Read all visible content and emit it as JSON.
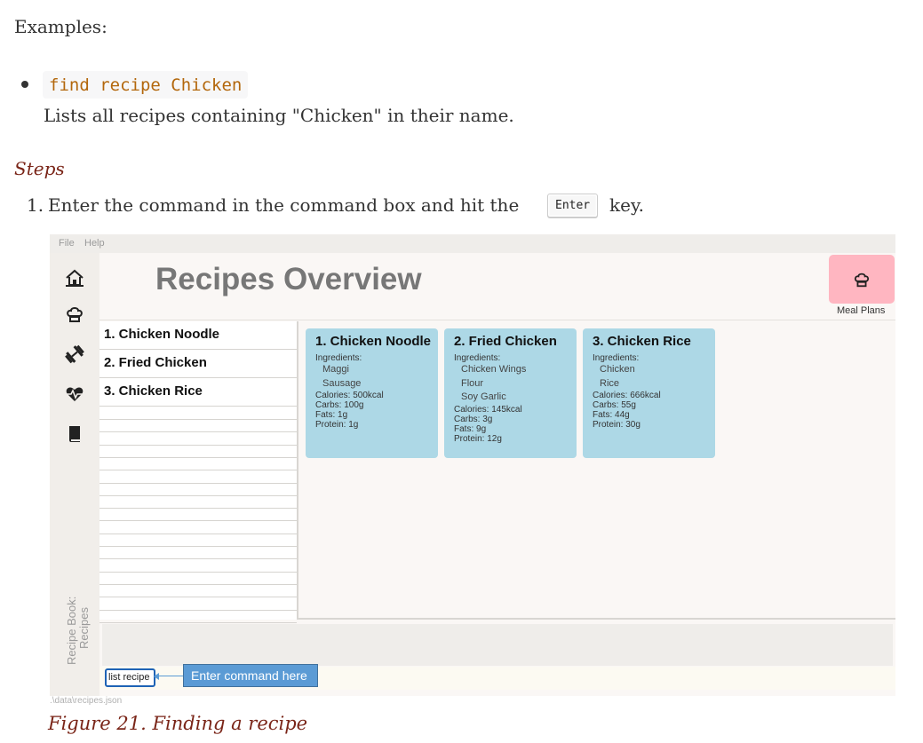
{
  "doc": {
    "examples_heading": "Examples:",
    "example_command": "find recipe Chicken",
    "example_description": "Lists all recipes containing \"Chicken\" in their name.",
    "steps_heading": "Steps",
    "step_number": "1.",
    "step_text_before": "Enter the command in the command box and hit the",
    "step_key": "Enter",
    "step_text_after": "key.",
    "figure_caption": "Figure 21. Finding a recipe"
  },
  "app": {
    "menu": {
      "file": "File",
      "help": "Help"
    },
    "sidebar": {
      "icons": [
        "home-icon",
        "chef-hat-icon",
        "dumbbell-icon",
        "heartbeat-icon",
        "diary-icon"
      ],
      "recipe_book_line1": "Recipe Book:",
      "recipe_book_line2": "Recipes"
    },
    "title": "Recipes Overview",
    "meal_plans_label": "Meal Plans",
    "recipe_list": [
      "1.  Chicken Noodle",
      "2.  Fried Chicken",
      "3.  Chicken Rice"
    ],
    "cards": [
      {
        "title": "1.  Chicken Noodle",
        "ingredients_label": "Ingredients:",
        "ingredients": [
          "Maggi",
          "Sausage"
        ],
        "calories": "Calories: 500kcal",
        "carbs": "Carbs: 100g",
        "fats": "Fats: 1g",
        "protein": "Protein: 1g"
      },
      {
        "title": "2.  Fried Chicken",
        "ingredients_label": "Ingredients:",
        "ingredients": [
          "Chicken Wings",
          "Flour",
          "Soy Garlic"
        ],
        "calories": "Calories: 145kcal",
        "carbs": "Carbs: 3g",
        "fats": "Fats: 9g",
        "protein": "Protein: 12g"
      },
      {
        "title": "3.  Chicken Rice",
        "ingredients_label": "Ingredients:",
        "ingredients": [
          "Chicken",
          "Rice"
        ],
        "calories": "Calories: 666kcal",
        "carbs": "Carbs: 55g",
        "fats": "Fats: 44g",
        "protein": "Protein: 30g"
      }
    ],
    "command_input_value": "list recipe",
    "annotation": "Enter command here",
    "status_path": ".\\data\\recipes.json",
    "colors": {
      "meal_plans_button": "#ffb6c1",
      "card": "#add8e6",
      "command_border": "#1e63b5",
      "annotation": "#5b9bd5"
    }
  }
}
